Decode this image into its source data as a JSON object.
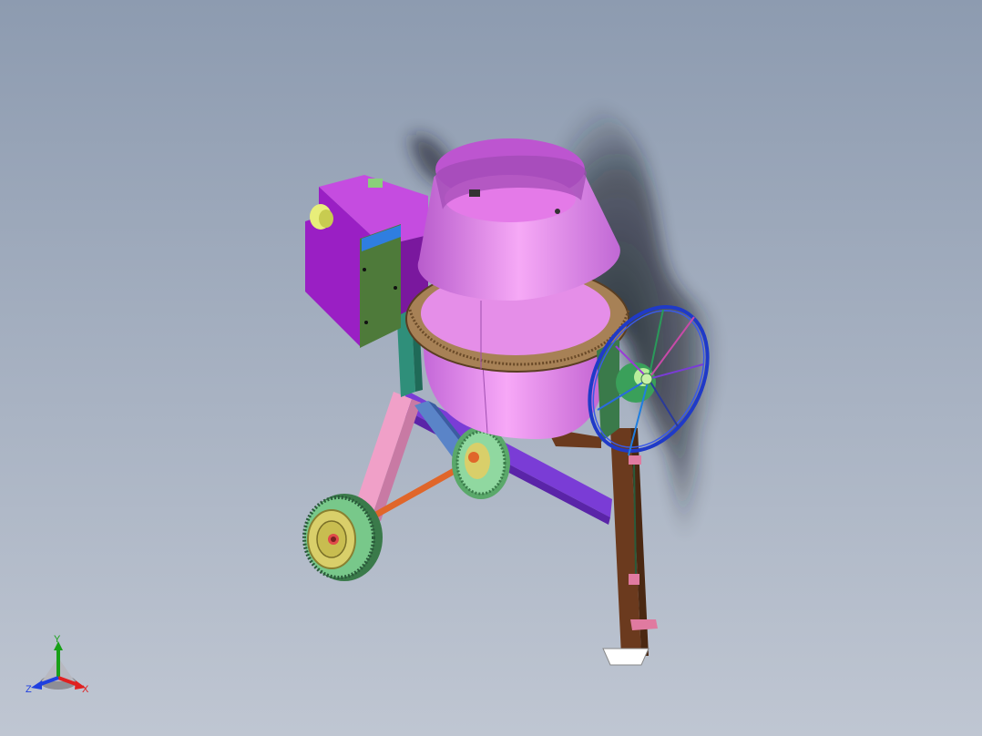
{
  "viewport": {
    "background_top": "#8d9bb0",
    "background_bottom": "#bfc6d2"
  },
  "model": {
    "name": "concrete-mixer",
    "part_colors": {
      "drum": "#e07ae8",
      "drum_ring": "#a78156",
      "motor_housing": "#9a1fc4",
      "frame": "#2f8f7a",
      "leg_front": "#f0a0c8",
      "leg_rear": "#6b3a1e",
      "cross_beam": "#7a3cd6",
      "axle": "#e0662a",
      "wheel_tire": "#78c88a",
      "wheel_hub": "#d9cf6a",
      "handwheel": "#1f3ac8",
      "pedal": "#e07aa0",
      "gear": "#3aa05a"
    }
  },
  "triad": {
    "x_label": "X",
    "y_label": "Y",
    "z_label": "Z",
    "x_color": "#e02020",
    "y_color": "#18a018",
    "z_color": "#2040e0"
  }
}
